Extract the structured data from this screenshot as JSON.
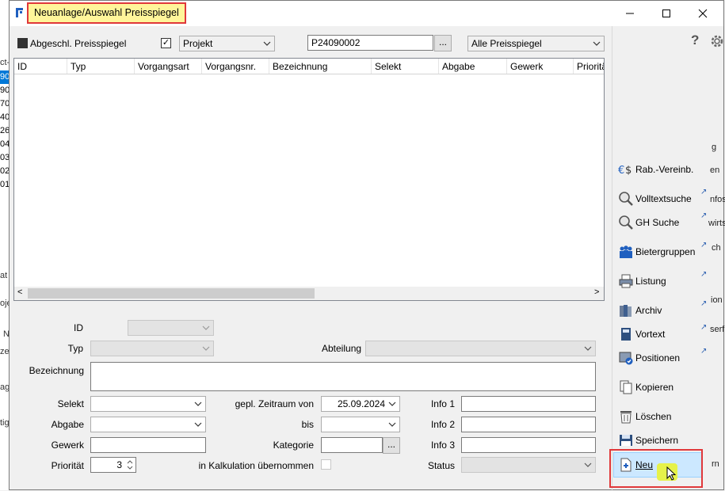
{
  "background": {
    "left_rows": [
      "90",
      "90",
      "70",
      "40",
      "26",
      "04",
      "03",
      "02",
      "01"
    ],
    "left_fragments": [
      "ct-",
      "at",
      "oje",
      "N",
      "zei",
      "ag",
      "tig"
    ],
    "right_fragments": [
      "g",
      "en",
      "nfos",
      "wirts",
      "ch",
      "ion",
      "serf",
      "rn"
    ]
  },
  "titlebar": {
    "title": "Neuanlage/Auswahl Preisspiegel",
    "minimize": "—",
    "maximize": "☐",
    "close": "✕"
  },
  "toolbar": {
    "abgeschl_label": "Abgeschl. Preisspiegel",
    "projekt_checked": "✓",
    "projekt_value": "Projekt",
    "number_value": "P24090002",
    "number_button": "...",
    "filter_value": "Alle Preisspiegel",
    "help": "?"
  },
  "grid": {
    "columns": [
      "ID",
      "Typ",
      "Vorgangsart",
      "Vorgangsnr.",
      "Bezeichnung",
      "Selekt",
      "Abgabe",
      "Gewerk",
      "Prioritä"
    ],
    "scroll_left": "<",
    "scroll_right": ">"
  },
  "form": {
    "id_label": "ID",
    "typ_label": "Typ",
    "abteilung_label": "Abteilung",
    "bezeichnung_label": "Bezeichnung",
    "selekt_label": "Selekt",
    "zeitraum_label": "gepl. Zeitraum von",
    "zeitraum_von": "25.09.2024",
    "info1_label": "Info 1",
    "abgabe_label": "Abgabe",
    "bis_label": "bis",
    "info2_label": "Info 2",
    "gewerk_label": "Gewerk",
    "kategorie_label": "Kategorie",
    "kategorie_button": "...",
    "info3_label": "Info 3",
    "prioritaet_label": "Priorität",
    "prioritaet_value": "3",
    "kalkulation_label": "in Kalkulation übernommen",
    "status_label": "Status"
  },
  "sidebar": {
    "items": [
      {
        "label": "Rab.-Vereinb.",
        "icon": "euro-icon"
      },
      {
        "label": "Volltextsuche",
        "icon": "magnifier-icon"
      },
      {
        "label": "GH Suche",
        "icon": "magnifier-icon"
      },
      {
        "label": "Bietergruppen",
        "icon": "people-icon"
      },
      {
        "label": "Listung",
        "icon": "printer-icon"
      },
      {
        "label": "Archiv",
        "icon": "archive-icon"
      },
      {
        "label": "Vortext",
        "icon": "book-icon"
      },
      {
        "label": "Positionen",
        "icon": "positions-icon"
      },
      {
        "label": "Kopieren",
        "icon": "copy-icon"
      },
      {
        "label": "Löschen",
        "icon": "trash-icon"
      },
      {
        "label": "Speichern",
        "icon": "save-icon"
      },
      {
        "label": "Neu",
        "icon": "new-icon"
      }
    ],
    "external_marker": "↗"
  },
  "colors": {
    "highlight_border": "#e0383a",
    "title_highlight": "#fff59a",
    "selection": "#cce8ff"
  }
}
